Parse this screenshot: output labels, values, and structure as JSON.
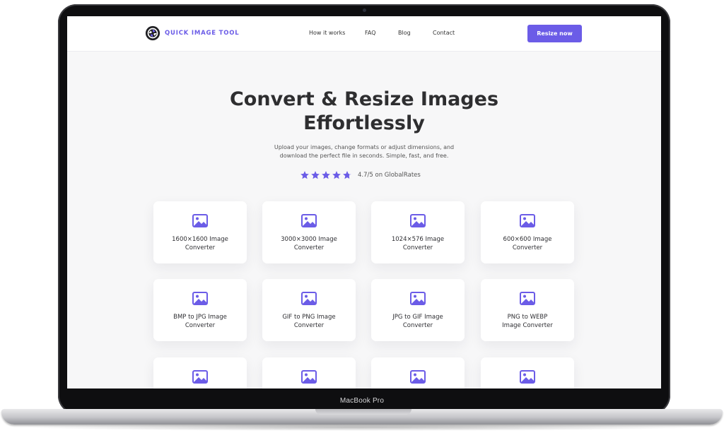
{
  "device": {
    "label": "MacBook Pro"
  },
  "header": {
    "brand_name": "QUICK IMAGE TOOL",
    "nav": [
      {
        "label": "How it works"
      },
      {
        "label": "FAQ"
      },
      {
        "label": "Blog"
      },
      {
        "label": "Contact"
      }
    ],
    "cta_label": "Resize now"
  },
  "hero": {
    "title_line1": "Convert & Resize Images",
    "title_line2": "Effortlessly",
    "subtitle_line1": "Upload your images, change formats or adjust dimensions, and",
    "subtitle_line2": "download the perfect file in seconds. Simple, fast, and free.",
    "rating": {
      "stars_filled": 4.7,
      "stars_total": 5,
      "text": "4.7/5 on GlobalRates"
    }
  },
  "tools": [
    {
      "line1": "1600×1600 Image",
      "line2": "Converter"
    },
    {
      "line1": "3000×3000 Image",
      "line2": "Converter"
    },
    {
      "line1": "1024×576 Image",
      "line2": "Converter"
    },
    {
      "line1": "600×600 Image",
      "line2": "Converter"
    },
    {
      "line1": "BMP to JPG Image",
      "line2": "Converter"
    },
    {
      "line1": "GIF to PNG Image",
      "line2": "Converter"
    },
    {
      "line1": "JPG to GIF Image",
      "line2": "Converter"
    },
    {
      "line1": "PNG to WEBP",
      "line2": "Image Converter"
    },
    {
      "line1": "",
      "line2": ""
    },
    {
      "line1": "",
      "line2": ""
    },
    {
      "line1": "",
      "line2": ""
    },
    {
      "line1": "",
      "line2": ""
    }
  ],
  "colors": {
    "accent": "#6b5ce7",
    "text": "#2e2e30",
    "muted": "#555555"
  },
  "icons": {
    "brand": "aperture-logo-icon",
    "tool": "image-icon",
    "star": "star-icon"
  }
}
